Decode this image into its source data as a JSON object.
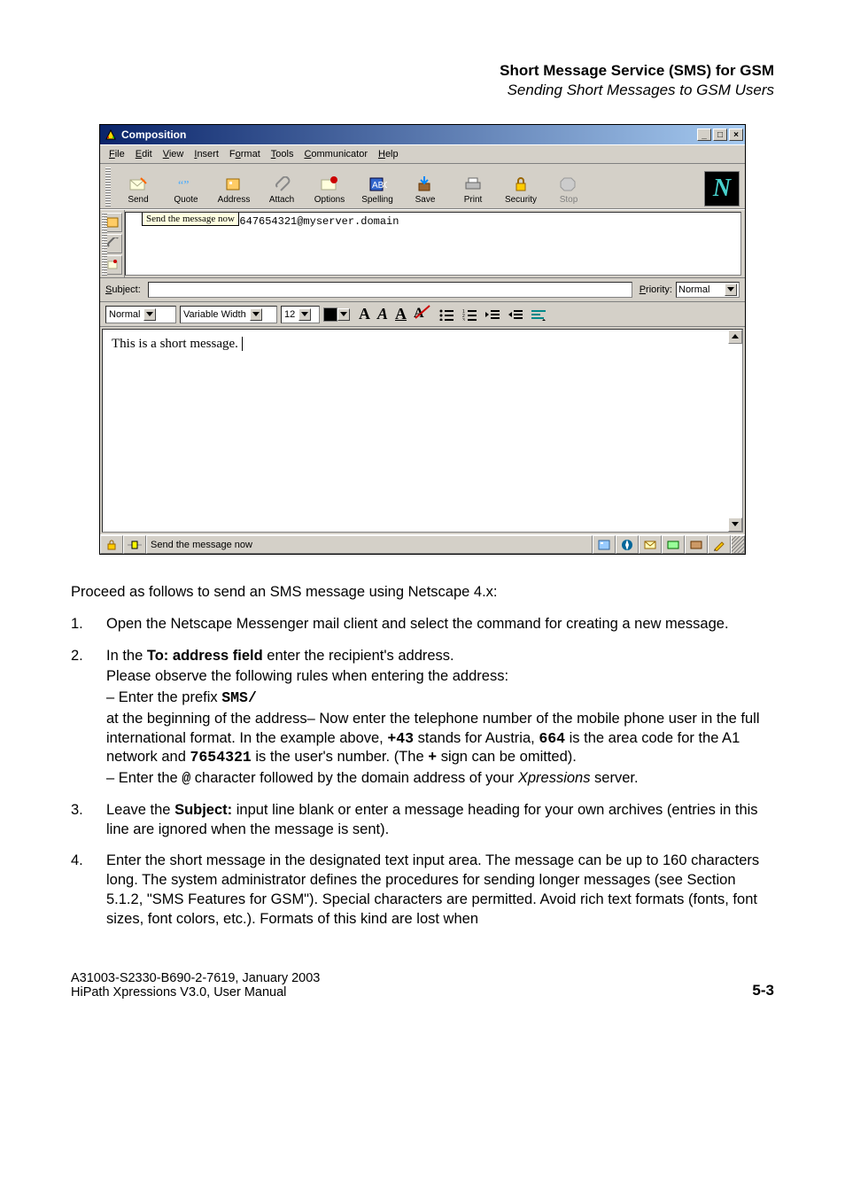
{
  "header": {
    "title": "Short Message Service (SMS) for GSM",
    "subtitle": "Sending Short Messages to GSM Users"
  },
  "win": {
    "title": "Composition",
    "sysbuttons": {
      "min": "_",
      "max": "□",
      "close": "×"
    },
    "menu": [
      "File",
      "Edit",
      "View",
      "Insert",
      "Format",
      "Tools",
      "Communicator",
      "Help"
    ],
    "menu_underline": [
      "F",
      "E",
      "V",
      "I",
      "o",
      "T",
      "C",
      "H"
    ],
    "toolbar": [
      {
        "name": "send",
        "label": "Send"
      },
      {
        "name": "quote",
        "label": "Quote"
      },
      {
        "name": "address",
        "label": "Address"
      },
      {
        "name": "attach",
        "label": "Attach"
      },
      {
        "name": "options",
        "label": "Options"
      },
      {
        "name": "spelling",
        "label": "Spelling"
      },
      {
        "name": "save",
        "label": "Save"
      },
      {
        "name": "print",
        "label": "Print"
      },
      {
        "name": "security",
        "label": "Security"
      },
      {
        "name": "stop",
        "label": "Stop",
        "disabled": true
      }
    ],
    "throbber": "N",
    "tooltip": "Send the message now",
    "addr_to_prefix": "To:",
    "addr_to_value": "sms/+430647654321@myserver.domain",
    "subject_label": "Subject:",
    "priority_label": "Priority:",
    "priority_value": "Normal",
    "fmt": {
      "para": "Normal",
      "font": "Variable Width",
      "size": "12"
    },
    "body": "This is a short message.",
    "status": "Send the message now"
  },
  "intro": "Proceed as follows to send an SMS message using Netscape 4.x:",
  "steps": {
    "s1": "Open the Netscape Messenger mail client and select the command for creating a new message.",
    "s2_lead": "In the ",
    "s2_bold": "To: address field",
    "s2_tail": " enter the recipient's address.",
    "s2_line2": "Please observe the following rules when entering the address:",
    "s2_b1a": "– Enter the prefix ",
    "s2_b1_code": "SMS/",
    "s2_b2a": " at the beginning of the address– Now enter the telephone number of the mobile phone user in the full international format. In the example above, ",
    "s2_b2_code1": "+43",
    "s2_b2_mid1": " stands for Austria, ",
    "s2_b2_code2": "664",
    "s2_b2_mid2": " is the area code for the A1 network and ",
    "s2_b2_code3": "7654321",
    "s2_b2_mid3": " is the user's number. (The ",
    "s2_b2_code4": "+",
    "s2_b2_tail": " sign can be omitted).",
    "s2_b3a": "– Enter the ",
    "s2_b3_code": "@",
    "s2_b3_mid": " character followed by the domain address of your ",
    "s2_b3_ital": "Xpressions",
    "s2_b3_tail": " server.",
    "s3_a": "Leave the ",
    "s3_bold": "Subject:",
    "s3_b": " input line blank or enter a message heading for your own archives (entries in this line are ignored when the message is sent).",
    "s4": "Enter the short message in the designated text input area. The message can be up to 160 characters long. The system administrator defines the procedures for sending longer messages (see Section 5.1.2, \"SMS Features for GSM\"). Special characters are permitted. Avoid rich text formats (fonts, font sizes, font colors, etc.). Formats of this kind are lost when"
  },
  "footer": {
    "line1": "A31003-S2330-B690-2-7619, January 2003",
    "line2": "HiPath Xpressions V3.0, User Manual",
    "page": "5-3"
  }
}
